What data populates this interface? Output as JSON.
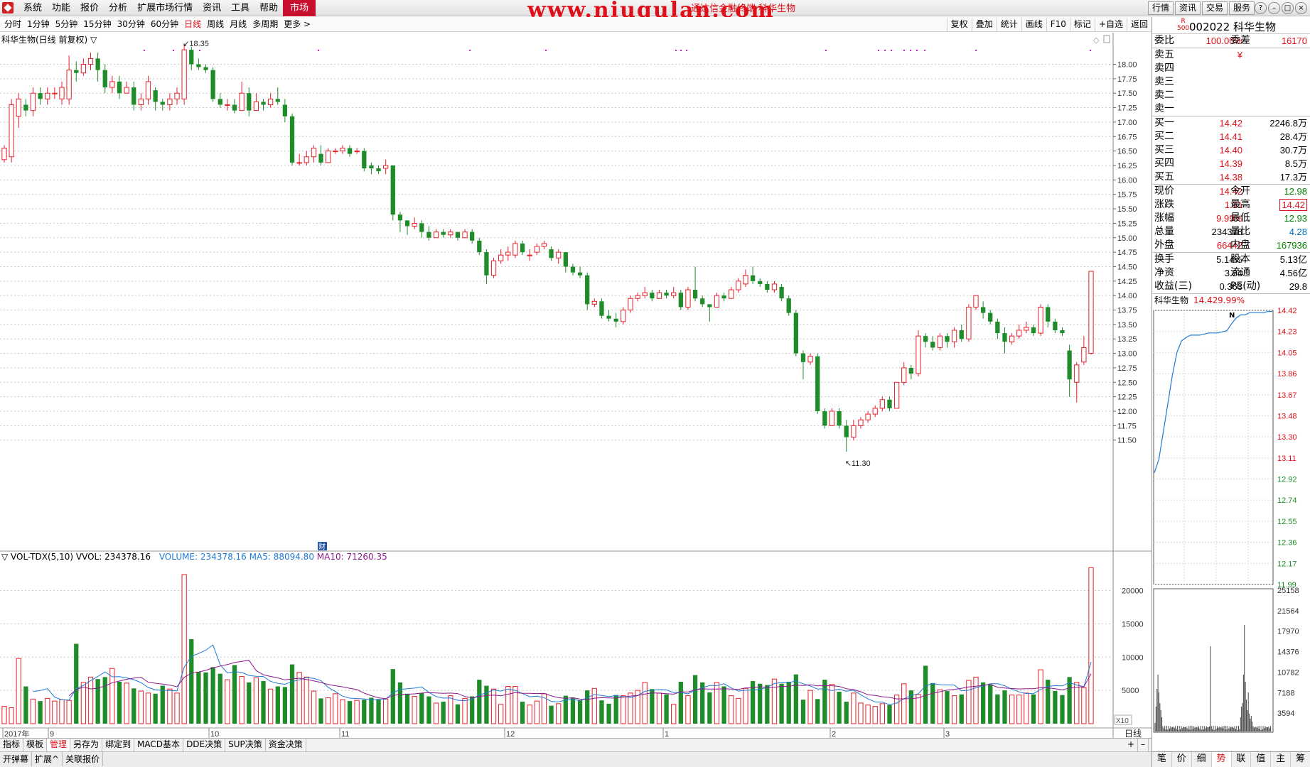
{
  "menubar": {
    "items": [
      "系统",
      "功能",
      "报价",
      "分析",
      "扩展市场行情",
      "资讯",
      "工具",
      "帮助",
      "市场"
    ],
    "site_title": "www.niugulan.com",
    "tip": "通达信金融终端 科华生物",
    "right_buttons": [
      "行情",
      "资讯",
      "交易",
      "服务"
    ],
    "window_controls": [
      "?",
      "–",
      "□",
      "×"
    ]
  },
  "periodbar": {
    "periods": [
      "分时",
      "1分钟",
      "5分钟",
      "15分钟",
      "30分钟",
      "60分钟",
      "日线",
      "周线",
      "月线",
      "多周期",
      "更多 >"
    ],
    "active_period": "日线",
    "tools": [
      "复权",
      "叠加",
      "统计",
      "画线",
      "F10",
      "标记",
      "+自选",
      "返回"
    ]
  },
  "main_chart": {
    "title": "科华生物(日线 前复权) ▽",
    "high_label": "18.35",
    "low_label": "11.30",
    "cai_badge": "财",
    "y_ticks": [
      "18.00",
      "17.75",
      "17.50",
      "17.25",
      "17.00",
      "16.75",
      "16.50",
      "16.25",
      "16.00",
      "15.75",
      "15.50",
      "15.25",
      "15.00",
      "14.75",
      "14.50",
      "14.25",
      "14.00",
      "13.75",
      "13.50",
      "13.25",
      "13.00",
      "12.75",
      "12.50",
      "12.25",
      "12.00",
      "11.75",
      "11.50"
    ],
    "x_labels": [
      "2017年",
      "9",
      "10",
      "11",
      "12",
      "1",
      "2",
      "3"
    ],
    "right_bottom_label": "日线"
  },
  "volume_chart": {
    "legend_name": "▽ VOL-TDX(5,10)",
    "vvol": "VVOL: 234378.16",
    "volume": "VOLUME: 234378.16",
    "ma5": "MA5: 88094.80",
    "ma10": "MA10: 71260.35",
    "y_ticks": [
      "20000",
      "15000",
      "10000",
      "5000"
    ],
    "unit_label": "X10"
  },
  "chart_data": {
    "type": "candlestick",
    "ylim": [
      11.3,
      18.35
    ],
    "high": 18.35,
    "low": 11.3,
    "ohlc": [
      [
        16.35,
        16.55,
        16.3,
        16.6
      ],
      [
        16.4,
        17.3,
        16.3,
        17.4
      ],
      [
        17.1,
        17.4,
        16.9,
        17.5
      ],
      [
        17.3,
        17.2,
        17.1,
        17.4
      ],
      [
        17.2,
        17.5,
        17.1,
        17.6
      ],
      [
        17.5,
        17.4,
        17.3,
        17.6
      ],
      [
        17.4,
        17.5,
        17.3,
        17.6
      ],
      [
        17.5,
        17.5,
        17.4,
        17.6
      ],
      [
        17.4,
        17.6,
        17.3,
        17.7
      ],
      [
        17.4,
        17.9,
        17.3,
        18.15
      ],
      [
        17.9,
        17.85,
        17.7,
        18.05
      ],
      [
        17.85,
        18.0,
        17.8,
        18.1
      ],
      [
        18.0,
        18.1,
        17.9,
        18.2
      ],
      [
        18.1,
        17.9,
        17.7,
        18.2
      ],
      [
        17.9,
        17.6,
        17.5,
        18.0
      ],
      [
        17.6,
        17.7,
        17.5,
        17.8
      ],
      [
        17.7,
        17.5,
        17.4,
        17.8
      ],
      [
        17.5,
        17.6,
        17.5,
        17.7
      ],
      [
        17.6,
        17.3,
        17.2,
        17.7
      ],
      [
        17.3,
        17.4,
        17.2,
        17.5
      ],
      [
        17.4,
        17.7,
        17.3,
        17.8
      ],
      [
        17.55,
        17.35,
        17.2,
        17.6
      ],
      [
        17.35,
        17.3,
        17.2,
        17.4
      ],
      [
        17.3,
        17.4,
        17.2,
        17.5
      ],
      [
        17.4,
        17.5,
        17.3,
        17.6
      ],
      [
        17.4,
        18.25,
        17.3,
        18.35
      ],
      [
        18.25,
        18.0,
        17.9,
        18.3
      ],
      [
        18.0,
        17.95,
        17.9,
        18.1
      ],
      [
        17.95,
        17.9,
        17.85,
        18.0
      ],
      [
        17.9,
        17.4,
        17.35,
        17.95
      ],
      [
        17.4,
        17.3,
        17.25,
        17.5
      ],
      [
        17.3,
        17.3,
        17.2,
        17.4
      ],
      [
        17.3,
        17.2,
        17.15,
        17.4
      ],
      [
        17.2,
        17.5,
        17.2,
        17.7
      ],
      [
        17.5,
        17.2,
        17.1,
        17.6
      ],
      [
        17.2,
        17.35,
        17.2,
        17.5
      ],
      [
        17.35,
        17.3,
        17.2,
        17.4
      ],
      [
        17.3,
        17.4,
        17.25,
        17.5
      ],
      [
        17.4,
        17.35,
        17.3,
        17.6
      ],
      [
        17.3,
        17.1,
        17.0,
        17.4
      ],
      [
        17.1,
        16.3,
        16.25,
        17.15
      ],
      [
        16.3,
        16.3,
        16.25,
        16.45
      ],
      [
        16.3,
        16.4,
        16.25,
        16.5
      ],
      [
        16.4,
        16.55,
        16.3,
        16.6
      ],
      [
        16.45,
        16.3,
        16.25,
        16.6
      ],
      [
        16.3,
        16.5,
        16.3,
        16.55
      ],
      [
        16.5,
        16.5,
        16.45,
        16.55
      ],
      [
        16.5,
        16.55,
        16.45,
        16.6
      ],
      [
        16.55,
        16.45,
        16.4,
        16.6
      ],
      [
        16.5,
        16.5,
        16.45,
        16.55
      ],
      [
        16.5,
        16.2,
        16.15,
        16.55
      ],
      [
        16.25,
        16.2,
        16.1,
        16.3
      ],
      [
        16.2,
        16.15,
        16.1,
        16.25
      ],
      [
        16.2,
        16.25,
        16.1,
        16.35
      ],
      [
        16.25,
        15.4,
        15.3,
        16.25
      ],
      [
        15.4,
        15.3,
        15.1,
        15.45
      ],
      [
        15.3,
        15.2,
        15.05,
        15.3
      ],
      [
        15.2,
        15.25,
        15.15,
        15.35
      ],
      [
        15.25,
        15.1,
        15.0,
        15.3
      ],
      [
        15.1,
        15.0,
        14.95,
        15.2
      ],
      [
        15.0,
        15.1,
        15.0,
        15.15
      ],
      [
        15.1,
        15.05,
        15.0,
        15.15
      ],
      [
        15.05,
        15.1,
        15.0,
        15.15
      ],
      [
        15.1,
        15.0,
        14.95,
        15.1
      ],
      [
        15.0,
        15.1,
        15.0,
        15.15
      ],
      [
        15.1,
        14.95,
        14.9,
        15.15
      ],
      [
        14.95,
        14.75,
        14.7,
        15.0
      ],
      [
        14.75,
        14.35,
        14.2,
        14.8
      ],
      [
        14.35,
        14.6,
        14.3,
        14.65
      ],
      [
        14.6,
        14.7,
        14.55,
        14.8
      ],
      [
        14.7,
        14.75,
        14.6,
        14.85
      ],
      [
        14.7,
        14.9,
        14.65,
        14.95
      ],
      [
        14.9,
        14.75,
        14.7,
        14.95
      ],
      [
        14.7,
        14.7,
        14.6,
        14.8
      ],
      [
        14.75,
        14.85,
        14.7,
        14.9
      ],
      [
        14.85,
        14.9,
        14.8,
        14.95
      ],
      [
        14.8,
        14.65,
        14.6,
        14.85
      ],
      [
        14.65,
        14.75,
        14.55,
        14.8
      ],
      [
        14.75,
        14.5,
        14.4,
        14.75
      ],
      [
        14.5,
        14.4,
        14.35,
        14.55
      ],
      [
        14.4,
        14.35,
        14.3,
        14.5
      ],
      [
        14.35,
        13.85,
        13.75,
        14.4
      ],
      [
        13.85,
        13.9,
        13.8,
        13.95
      ],
      [
        13.9,
        13.65,
        13.6,
        13.95
      ],
      [
        13.65,
        13.6,
        13.55,
        13.75
      ],
      [
        13.6,
        13.55,
        13.45,
        13.7
      ],
      [
        13.55,
        13.75,
        13.5,
        13.8
      ],
      [
        13.75,
        13.95,
        13.7,
        14.0
      ],
      [
        13.95,
        14.0,
        13.9,
        14.05
      ],
      [
        14.0,
        14.05,
        13.95,
        14.15
      ],
      [
        14.05,
        13.95,
        13.9,
        14.1
      ],
      [
        13.95,
        14.05,
        13.95,
        14.1
      ],
      [
        14.05,
        14.0,
        13.95,
        14.1
      ],
      [
        14.0,
        14.05,
        13.95,
        14.15
      ],
      [
        14.05,
        13.8,
        13.75,
        14.1
      ],
      [
        13.8,
        14.1,
        13.75,
        14.15
      ],
      [
        14.1,
        13.95,
        13.9,
        14.5
      ],
      [
        13.95,
        13.85,
        13.8,
        14.0
      ],
      [
        13.85,
        13.8,
        13.55,
        13.85
      ],
      [
        13.8,
        14.0,
        13.8,
        14.05
      ],
      [
        14.0,
        13.95,
        13.9,
        14.05
      ],
      [
        13.95,
        14.1,
        13.95,
        14.15
      ],
      [
        14.1,
        14.25,
        14.05,
        14.3
      ],
      [
        14.2,
        14.35,
        14.15,
        14.45
      ],
      [
        14.35,
        14.25,
        14.2,
        14.5
      ],
      [
        14.25,
        14.2,
        14.15,
        14.3
      ],
      [
        14.2,
        14.1,
        14.05,
        14.25
      ],
      [
        14.1,
        14.2,
        14.05,
        14.25
      ],
      [
        14.15,
        13.95,
        13.9,
        14.2
      ],
      [
        13.95,
        13.7,
        13.65,
        14.0
      ],
      [
        13.7,
        13.0,
        12.95,
        13.75
      ],
      [
        13.0,
        12.85,
        12.55,
        13.05
      ],
      [
        12.85,
        12.95,
        12.8,
        13.0
      ],
      [
        12.95,
        12.0,
        11.95,
        13.0
      ],
      [
        12.0,
        11.75,
        11.7,
        12.05
      ],
      [
        11.75,
        12.0,
        11.75,
        12.05
      ],
      [
        12.0,
        11.75,
        11.7,
        12.05
      ],
      [
        11.75,
        11.55,
        11.3,
        11.85
      ],
      [
        11.55,
        11.75,
        11.5,
        11.85
      ],
      [
        11.75,
        11.85,
        11.7,
        11.9
      ],
      [
        11.85,
        11.95,
        11.8,
        12.0
      ],
      [
        11.95,
        12.05,
        11.9,
        12.1
      ],
      [
        12.05,
        12.2,
        12.0,
        12.25
      ],
      [
        12.2,
        12.05,
        12.0,
        12.25
      ],
      [
        12.05,
        12.5,
        12.05,
        12.5
      ],
      [
        12.5,
        12.75,
        12.45,
        12.85
      ],
      [
        12.75,
        12.65,
        12.55,
        12.8
      ],
      [
        12.65,
        13.3,
        12.6,
        13.4
      ],
      [
        13.3,
        13.2,
        13.1,
        13.35
      ],
      [
        13.2,
        13.1,
        13.05,
        13.3
      ],
      [
        13.1,
        13.3,
        13.05,
        13.35
      ],
      [
        13.3,
        13.2,
        13.1,
        13.35
      ],
      [
        13.2,
        13.4,
        13.1,
        13.45
      ],
      [
        13.4,
        13.25,
        13.2,
        13.5
      ],
      [
        13.25,
        13.8,
        13.2,
        13.85
      ],
      [
        13.8,
        14.0,
        13.75,
        14.0
      ],
      [
        13.8,
        13.7,
        13.6,
        13.9
      ],
      [
        13.7,
        13.55,
        13.5,
        13.75
      ],
      [
        13.55,
        13.35,
        13.25,
        13.6
      ],
      [
        13.35,
        13.2,
        13.0,
        13.45
      ],
      [
        13.2,
        13.3,
        13.15,
        13.35
      ],
      [
        13.3,
        13.4,
        13.25,
        13.5
      ],
      [
        13.4,
        13.45,
        13.35,
        13.55
      ],
      [
        13.45,
        13.35,
        13.3,
        13.5
      ],
      [
        13.35,
        13.8,
        13.3,
        13.85
      ],
      [
        13.8,
        13.55,
        13.45,
        13.85
      ],
      [
        13.55,
        13.4,
        13.35,
        13.6
      ],
      [
        13.4,
        13.35,
        13.3,
        13.45
      ],
      [
        13.05,
        12.55,
        12.25,
        13.15
      ],
      [
        12.5,
        12.8,
        12.15,
        12.85
      ],
      [
        12.85,
        13.1,
        12.8,
        13.3
      ],
      [
        13.0,
        14.42,
        12.98,
        14.42
      ]
    ],
    "volume_x10": [
      2600,
      2400,
      9800,
      5600,
      3700,
      3400,
      3800,
      3400,
      3600,
      3500,
      12000,
      6200,
      7000,
      6700,
      7000,
      8300,
      6300,
      6100,
      5300,
      4900,
      4600,
      4500,
      5700,
      5200,
      4600,
      22400,
      12700,
      7800,
      7700,
      8500,
      7500,
      6600,
      8800,
      7100,
      6200,
      6900,
      6400,
      5200,
      5600,
      5500,
      8900,
      7700,
      7000,
      4900,
      3800,
      3900,
      4500,
      3600,
      3400,
      3500,
      3600,
      3900,
      3700,
      3700,
      8200,
      6200,
      4500,
      4100,
      4600,
      4100,
      3100,
      3300,
      4200,
      2900,
      3800,
      4100,
      6600,
      5700,
      5200,
      2900,
      5600,
      5600,
      3300,
      2800,
      3400,
      4500,
      2700,
      3000,
      4200,
      3900,
      3500,
      5000,
      5300,
      3500,
      3000,
      4300,
      4200,
      4600,
      5000,
      6200,
      5200,
      4600,
      4400,
      2900,
      6300,
      4200,
      7300,
      6200,
      4700,
      6200,
      5600,
      4200,
      3800,
      5300,
      6400,
      6000,
      5800,
      6700,
      6000,
      6300,
      7400,
      3600,
      5000,
      3700,
      6600,
      5900,
      4800,
      3300,
      4600,
      3100,
      2800,
      2600,
      3000,
      2800,
      4300,
      6000,
      5000,
      4400,
      8700,
      6100,
      5100,
      4900,
      4200,
      4400,
      6500,
      7000,
      6200,
      5900,
      4400,
      5000,
      4300,
      4300,
      4600,
      4400,
      8100,
      6600,
      4900,
      4300,
      7000,
      6200,
      5400,
      23437
    ],
    "series": [
      {
        "name": "MA5",
        "color": "#1f7bd6"
      },
      {
        "name": "MA10",
        "color": "#8b1a8b"
      }
    ],
    "mini_intraday": {
      "title": "科华生物",
      "price": "14.42",
      "pct": "9.99%",
      "y_labels": [
        "14.42",
        "14.23",
        "14.05",
        "13.86",
        "13.67",
        "13.48",
        "13.30",
        "13.11",
        "12.92",
        "12.74",
        "12.55",
        "12.36",
        "12.17",
        "11.99"
      ],
      "vol_labels": [
        "25158",
        "21564",
        "17970",
        "14376",
        "10782",
        "7188",
        "3594"
      ],
      "points": [
        12.98,
        13.1,
        13.35,
        13.6,
        13.85,
        14.05,
        14.15,
        14.18,
        14.2,
        14.2,
        14.2,
        14.21,
        14.22,
        14.22,
        14.22,
        14.23,
        14.24,
        14.3,
        14.35,
        14.38,
        14.38,
        14.4,
        14.4,
        14.4,
        14.4,
        14.41,
        14.41
      ]
    }
  },
  "quote": {
    "r_mark": "R\n500",
    "code_name": "002022 科华生物",
    "weibi_label": "委比",
    "weibi": "100.00%",
    "weicha_label": "委差",
    "weicha": "16170",
    "sell": [
      {
        "label": "卖五",
        "price": "¥",
        "vol": ""
      },
      {
        "label": "卖四",
        "price": "",
        "vol": ""
      },
      {
        "label": "卖三",
        "price": "",
        "vol": ""
      },
      {
        "label": "卖二",
        "price": "",
        "vol": ""
      },
      {
        "label": "卖一",
        "price": "",
        "vol": ""
      }
    ],
    "buy": [
      {
        "label": "买一",
        "price": "14.42",
        "vol": "2246.8万"
      },
      {
        "label": "买二",
        "price": "14.41",
        "vol": "28.4万"
      },
      {
        "label": "买三",
        "price": "14.40",
        "vol": "30.7万"
      },
      {
        "label": "买四",
        "price": "14.39",
        "vol": "8.5万"
      },
      {
        "label": "买五",
        "price": "14.38",
        "vol": "17.3万"
      }
    ],
    "stats": [
      {
        "k": "现价",
        "v": "14.42",
        "c": "red",
        "k2": "今开",
        "v2": "12.98",
        "c2": "green"
      },
      {
        "k": "涨跌",
        "v": "1.31",
        "c": "red",
        "k2": "最高",
        "v2": "14.42",
        "c2": "red boxed"
      },
      {
        "k": "涨幅",
        "v": "9.99%",
        "c": "red",
        "k2": "最低",
        "v2": "12.93",
        "c2": "green"
      },
      {
        "k": "总量",
        "v": "234378",
        "c": "",
        "k2": "量比",
        "v2": "4.28",
        "c2": "blue"
      },
      {
        "k": "外盘",
        "v": "66442",
        "c": "red",
        "k2": "内盘",
        "v2": "167936",
        "c2": "green"
      }
    ],
    "fund": [
      {
        "k": "换手",
        "v": "5.14%",
        "k2": "股本",
        "v2": "5.13亿"
      },
      {
        "k": "净资",
        "v": "3.84",
        "k2": "流通",
        "v2": "4.56亿"
      },
      {
        "k": "收益(三)",
        "v": "0.363",
        "k2": "PE(动)",
        "v2": "29.8"
      }
    ],
    "tabs": [
      "笔",
      "价",
      "细",
      "势",
      "联",
      "值",
      "主",
      "筹"
    ],
    "active_tab": "势"
  },
  "bottom": {
    "tabs": [
      "指标",
      "模板",
      "管理",
      "另存为",
      "绑定到",
      "MACD基本",
      "DDE决策",
      "SUP决策",
      "资金决策"
    ],
    "active_tab": "管理",
    "status_items": [
      "开弹幕",
      "扩展^",
      "关联报价"
    ],
    "right_items": [
      "+",
      "–"
    ]
  }
}
